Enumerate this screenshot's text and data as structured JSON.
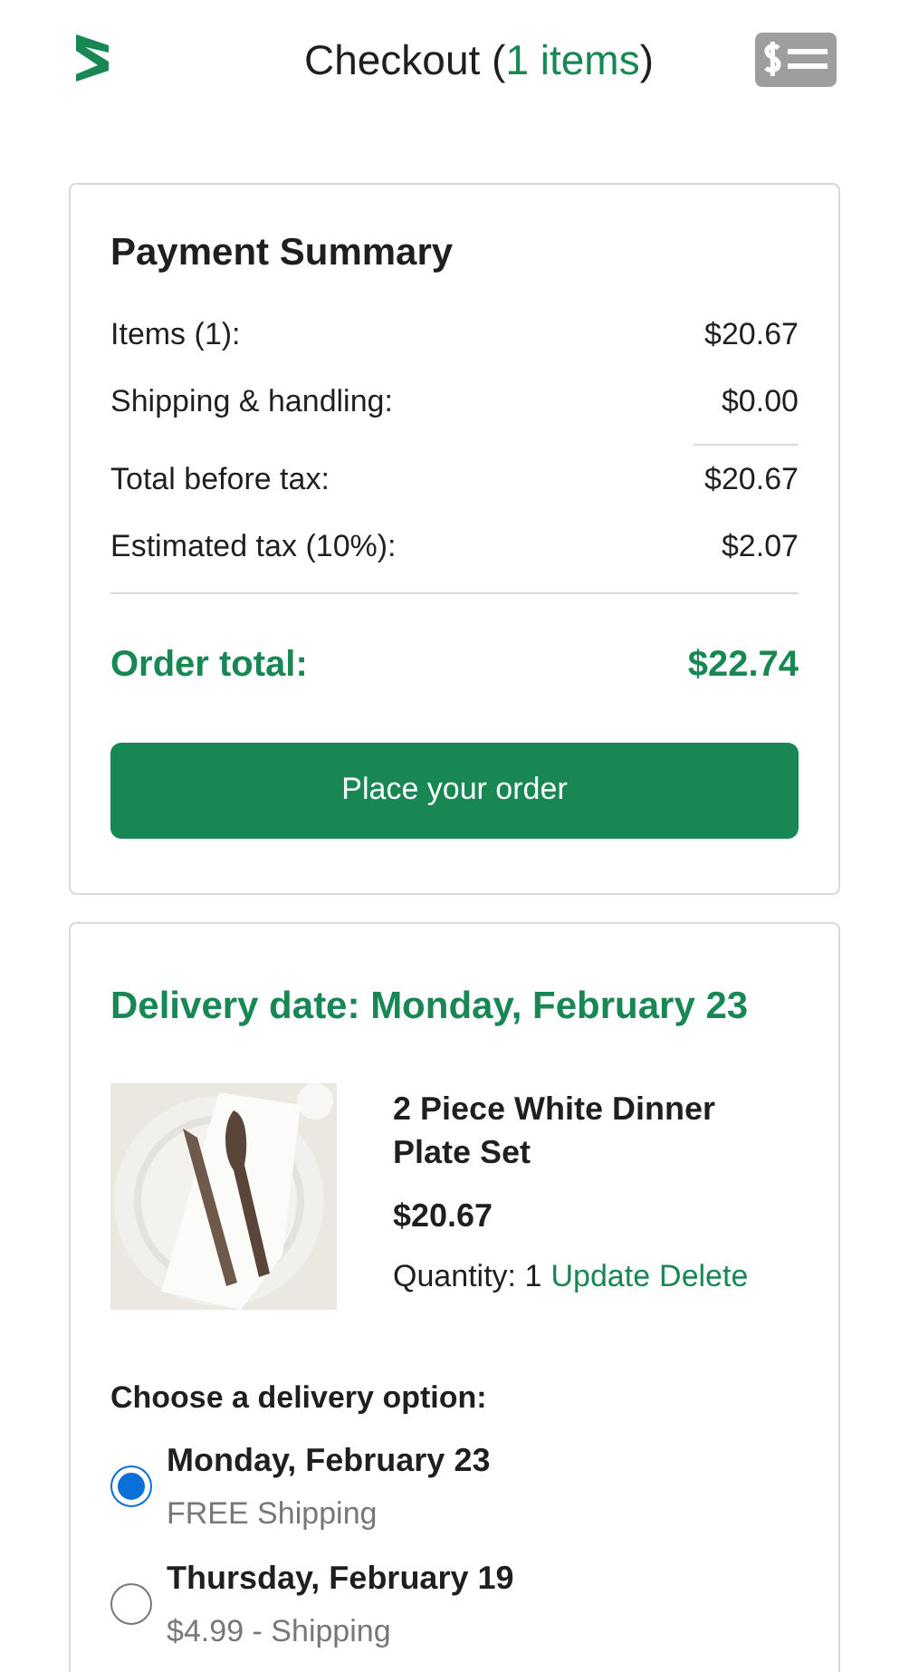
{
  "header": {
    "title": "Checkout",
    "count_open": "(",
    "count": "1 items",
    "count_close": ")"
  },
  "payment_summary": {
    "title": "Payment Summary",
    "row_groups": [
      [
        {
          "label": "Items (1):",
          "value": "$20.67"
        },
        {
          "label": "Shipping & handling:",
          "value": "$0.00"
        }
      ],
      [
        {
          "label": "Total before tax:",
          "value": "$20.67"
        },
        {
          "label": "Estimated tax (10%):",
          "value": "$2.07"
        }
      ]
    ],
    "total_label": "Order total:",
    "total_value": "$22.74",
    "button": "Place your order"
  },
  "delivery": {
    "date_label": "Delivery date: Monday, February 23",
    "product": {
      "name": "2 Piece White Dinner Plate Set",
      "price": "$20.67",
      "quantity_label": "Quantity: 1",
      "links": [
        "Update",
        "Delete"
      ]
    },
    "options_title": "Choose a delivery option:",
    "options": [
      {
        "date": "Monday, February 23",
        "price": "FREE Shipping",
        "selected": true
      },
      {
        "date": "Thursday, February 19",
        "price": "$4.99 - Shipping",
        "selected": false
      }
    ]
  }
}
